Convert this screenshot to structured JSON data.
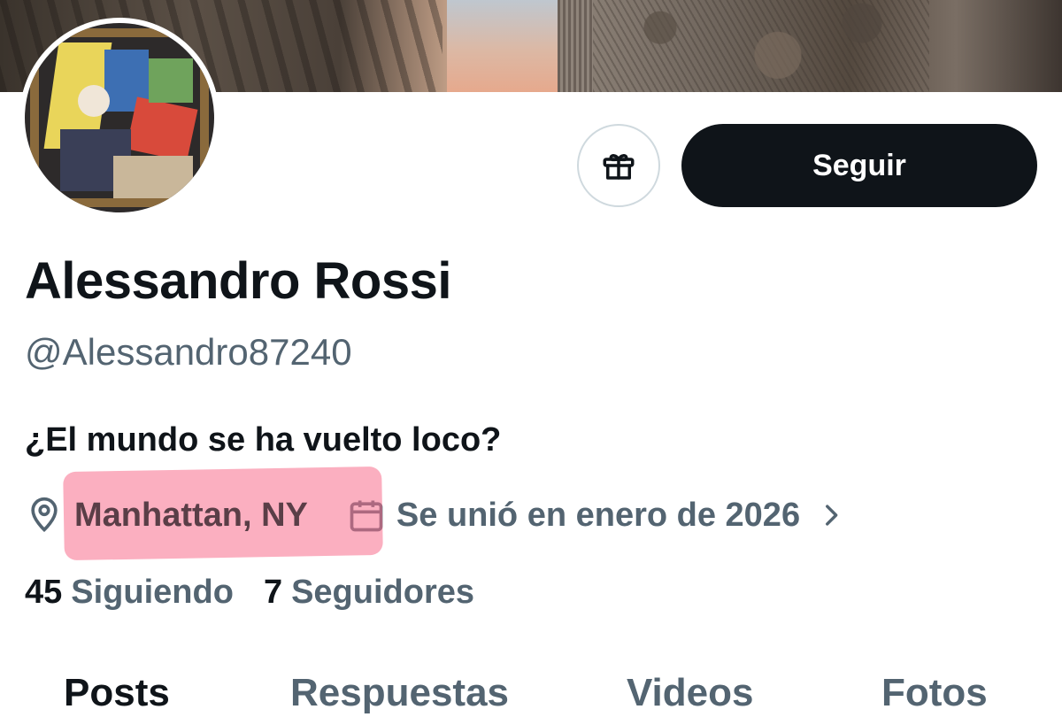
{
  "profile": {
    "name": "Alessandro Rossi",
    "handle": "@Alessandro87240",
    "bio": "¿El mundo se ha vuelto loco?",
    "location": "Manhattan, NY",
    "joined": "Se unió en enero de 2026",
    "following_count": "45",
    "following_label": "Siguiendo",
    "followers_count": "7",
    "followers_label": "Seguidores"
  },
  "actions": {
    "follow_label": "Seguir",
    "gift_icon": "gift-icon"
  },
  "tabs": [
    {
      "label": "Posts",
      "active": true
    },
    {
      "label": "Respuestas",
      "active": false
    },
    {
      "label": "Videos",
      "active": false
    },
    {
      "label": "Fotos",
      "active": false
    }
  ],
  "colors": {
    "text_primary": "#0f1419",
    "text_secondary": "#536471",
    "button_dark": "#0f1419",
    "highlight": "#f86e8c"
  }
}
